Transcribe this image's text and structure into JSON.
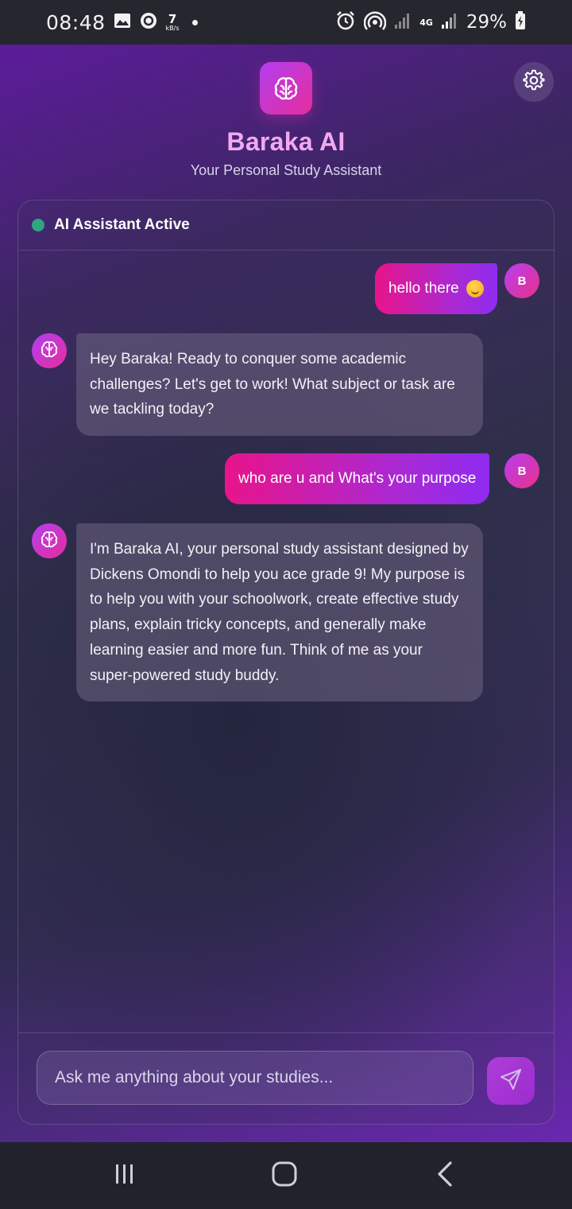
{
  "status_bar": {
    "time": "08:48",
    "speed_value": "7",
    "speed_unit": "kB/s",
    "network": "4G",
    "battery": "29%"
  },
  "header": {
    "title": "Baraka AI",
    "subtitle": "Your Personal Study Assistant"
  },
  "chat": {
    "status": "AI Assistant Active",
    "user_initial": "B",
    "messages": [
      {
        "role": "user",
        "text": "hello there"
      },
      {
        "role": "ai",
        "text": "Hey Baraka!  Ready to conquer some academic challenges? Let's get to work!  What subject or task are we tackling today?"
      },
      {
        "role": "user",
        "text": "who are u and  What's your purpose"
      },
      {
        "role": "ai",
        "text": "I'm Baraka AI, your personal study assistant designed by Dickens Omondi to help you ace grade 9!  My purpose is to help you with your schoolwork, create effective study plans, explain tricky concepts, and generally make learning easier and more fun.  Think of me as your super-powered study buddy."
      }
    ]
  },
  "input": {
    "placeholder": "Ask me anything about your studies..."
  },
  "icons": {
    "logo": "brain-icon",
    "settings": "gear-icon",
    "send": "send-icon"
  },
  "colors": {
    "accent_pink": "#e8148a",
    "accent_purple": "#8f2bf0",
    "title_pink": "#f2a9f0",
    "status_green": "#2ea680"
  }
}
